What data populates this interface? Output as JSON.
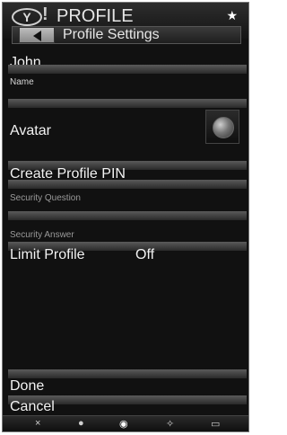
{
  "header": {
    "app_title": "PROFILE",
    "y_logo": "Y",
    "exclamation": "!",
    "star_icon": "★"
  },
  "subheader": {
    "title": "Profile Settings",
    "back_icon": "back-arrow-icon"
  },
  "fields": {
    "name_value": "John",
    "name_label": "Name",
    "avatar_label": "Avatar",
    "create_pin_label": "Create Profile PIN",
    "security_question_label": "Security Question",
    "security_answer_label": "Security Answer",
    "limit_profile_label": "Limit Profile",
    "limit_profile_value": "Off"
  },
  "actions": {
    "done_label": "Done",
    "cancel_label": "Cancel"
  },
  "footer": {
    "buttons": [
      {
        "icon": "close-icon",
        "glyph": "×"
      },
      {
        "icon": "circle-icon",
        "glyph": "●"
      },
      {
        "icon": "eye-icon",
        "glyph": "◉"
      },
      {
        "icon": "spark-icon",
        "glyph": "✧"
      },
      {
        "icon": "panel-icon",
        "glyph": "▭"
      }
    ]
  }
}
